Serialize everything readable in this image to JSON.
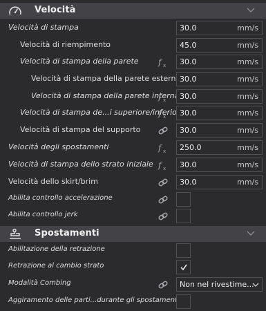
{
  "colors": {
    "background": "#2b2b2e",
    "header_bg": "#424247",
    "field_border": "#505055",
    "icon": "#a8a8ad"
  },
  "speed_section": {
    "title": "Velocità",
    "icon": "speedometer-icon",
    "rows": [
      {
        "label": "Velocità di stampa",
        "value": "30.0",
        "unit": "mm/s"
      },
      {
        "label": "Velocità di riempimento",
        "value": "45.0",
        "unit": "mm/s"
      },
      {
        "label": "Velocità di stampa della parete",
        "value": "30.0",
        "unit": "mm/s",
        "icon": "function-icon"
      },
      {
        "label": "Velocità di stampa della parete esterna",
        "value": "30.0",
        "unit": "mm/s"
      },
      {
        "label": "Velocità di stampa della parete interna",
        "value": "30.0",
        "unit": "mm/s",
        "icon": "function-icon"
      },
      {
        "label": "Velocità di stampa de...i superiore/inferiore",
        "value": "30.0",
        "unit": "mm/s",
        "icon": "function-icon"
      },
      {
        "label": "Velocità di stampa del supporto",
        "value": "30.0",
        "unit": "mm/s",
        "icon": "link-icon"
      },
      {
        "label": "Velocità degli spostamenti",
        "value": "250.0",
        "unit": "mm/s",
        "icon": "function-icon"
      },
      {
        "label": "Velocità di stampa dello strato iniziale",
        "value": "30.0",
        "unit": "mm/s",
        "icon": "function-icon"
      },
      {
        "label": "Velocità dello skirt/brim",
        "value": "30.0",
        "unit": "mm/s",
        "icon": "link-icon"
      },
      {
        "label": "Abilita controllo accelerazione",
        "checked": false,
        "icon": "link-icon"
      },
      {
        "label": "Abilita controllo jerk",
        "checked": false,
        "icon": "link-icon"
      }
    ]
  },
  "travel_section": {
    "title": "Spostamenti",
    "icon": "travel-icon",
    "rows": [
      {
        "label": "Abilitazione della retrazione",
        "checked": false
      },
      {
        "label": "Retrazione al cambio strato",
        "checked": true
      },
      {
        "label": "Modalità Combing",
        "value": "Non nel rivestime...",
        "icon": "link-icon"
      },
      {
        "label": "Aggiramento delle parti...durante gli spostamenti",
        "checked": false
      }
    ]
  }
}
